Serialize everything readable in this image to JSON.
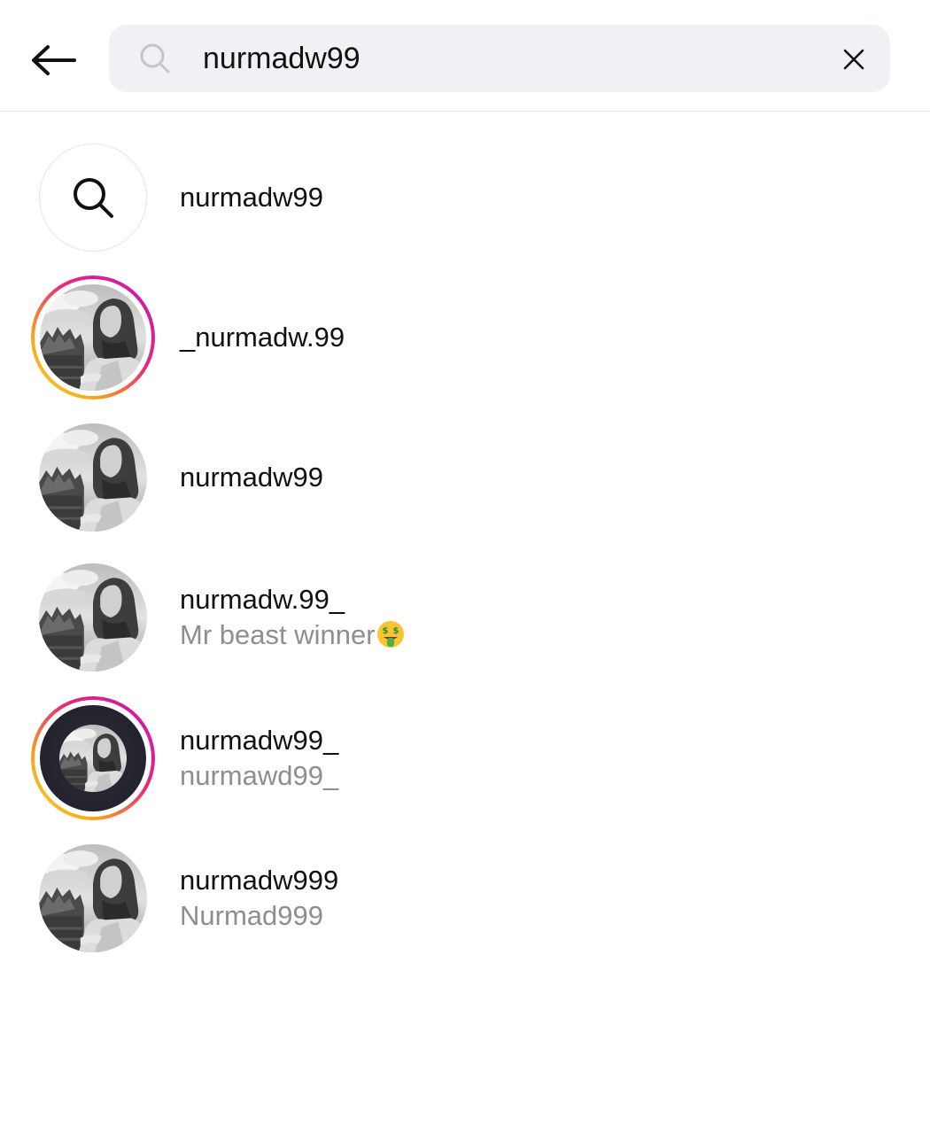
{
  "search": {
    "query": "nurmadw99",
    "icon": "search-icon",
    "clear_icon": "close-icon"
  },
  "header": {
    "back_icon": "arrow-left-icon"
  },
  "results": [
    {
      "type": "keyword",
      "username": "nurmadw99",
      "subtitle": ""
    },
    {
      "type": "account",
      "username": "_nurmadw.99",
      "subtitle": "",
      "story_ring": true
    },
    {
      "type": "account",
      "username": "nurmadw99",
      "subtitle": "",
      "story_ring": false
    },
    {
      "type": "account",
      "username": "nurmadw.99_",
      "subtitle": "Mr beast winner",
      "subtitle_emoji": "money-mouth-face",
      "story_ring": false
    },
    {
      "type": "account",
      "username": "nurmadw99_",
      "subtitle": "nurmawd99_",
      "story_ring": true
    },
    {
      "type": "account",
      "username": "nurmadw999",
      "subtitle": "Nurmad999",
      "story_ring": false
    }
  ],
  "colors": {
    "search_bg": "#eff1f4",
    "subtitle": "#8e8e8e",
    "ring_start": "#c913b9",
    "ring_end": "#fbd435"
  }
}
